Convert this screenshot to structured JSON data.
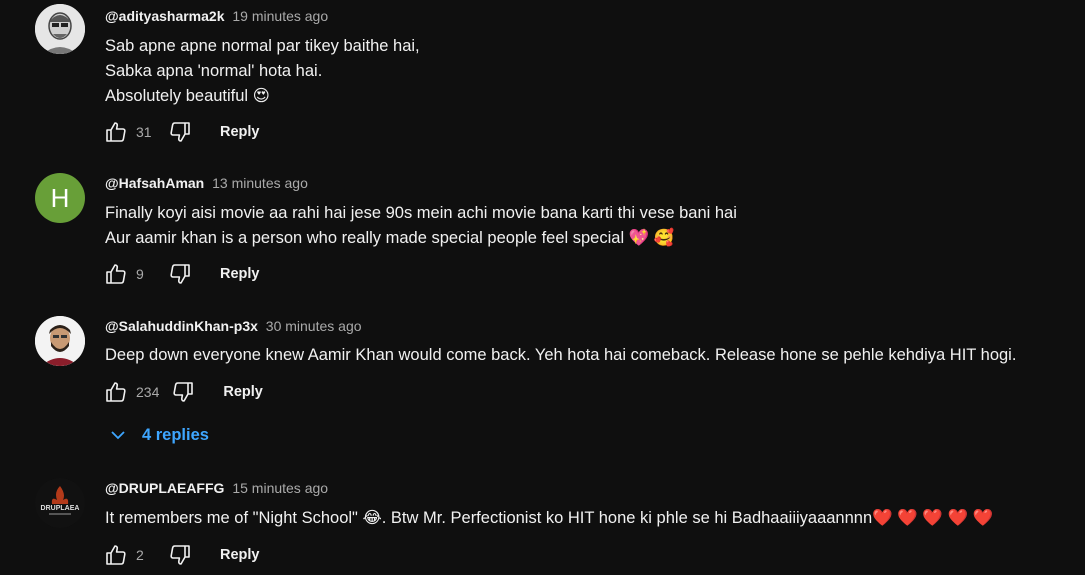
{
  "comments": [
    {
      "author": "@adityasharma2k",
      "time": "19 minutes ago",
      "lines": [
        "Sab apne apne normal par tikey baithe hai,",
        "Sabka apna 'normal' hota hai.",
        "Absolutely beautiful 😍"
      ],
      "likes": "31",
      "reply_label": "Reply",
      "avatar": {
        "type": "illustration",
        "bg": "#e6e6e6"
      }
    },
    {
      "author": "@HafsahAman",
      "time": "13 minutes ago",
      "lines": [
        "Finally koyi aisi movie aa rahi hai jese 90s mein achi movie bana karti thi vese bani hai",
        "Aur aamir khan is a person who really made special people feel special 💖 🥰"
      ],
      "likes": "9",
      "reply_label": "Reply",
      "avatar": {
        "type": "letter",
        "letter": "H",
        "bg": "#689f38"
      }
    },
    {
      "author": "@SalahuddinKhan-p3x",
      "time": "30 minutes ago",
      "lines": [
        "Deep down everyone knew Aamir Khan would come back. Yeh hota hai comeback. Release hone se pehle kehdiya HIT hogi."
      ],
      "likes": "234",
      "reply_label": "Reply",
      "avatar": {
        "type": "photo",
        "bg": "#f3f3f3"
      },
      "replies_label": "4 replies"
    },
    {
      "author": "@DRUPLAEAFFG",
      "time": "15 minutes ago",
      "lines": [
        "It remembers me of \"Night School\" 😂. Btw Mr. Perfectionist ko HIT hone ki phle se hi Badhaaiiiyaaannnn❤️ ❤️ ❤️ ❤️ ❤️"
      ],
      "likes": "2",
      "reply_label": "Reply",
      "avatar": {
        "type": "logo",
        "bg": "#111111"
      }
    }
  ],
  "colors": {
    "background": "#0f0f0f",
    "text": "#f1f1f1",
    "muted": "#aaaaaa",
    "accent": "#3ea6ff"
  },
  "icons": {
    "like": "thumbs-up-icon",
    "dislike": "thumbs-down-icon",
    "expand": "chevron-down-icon"
  }
}
